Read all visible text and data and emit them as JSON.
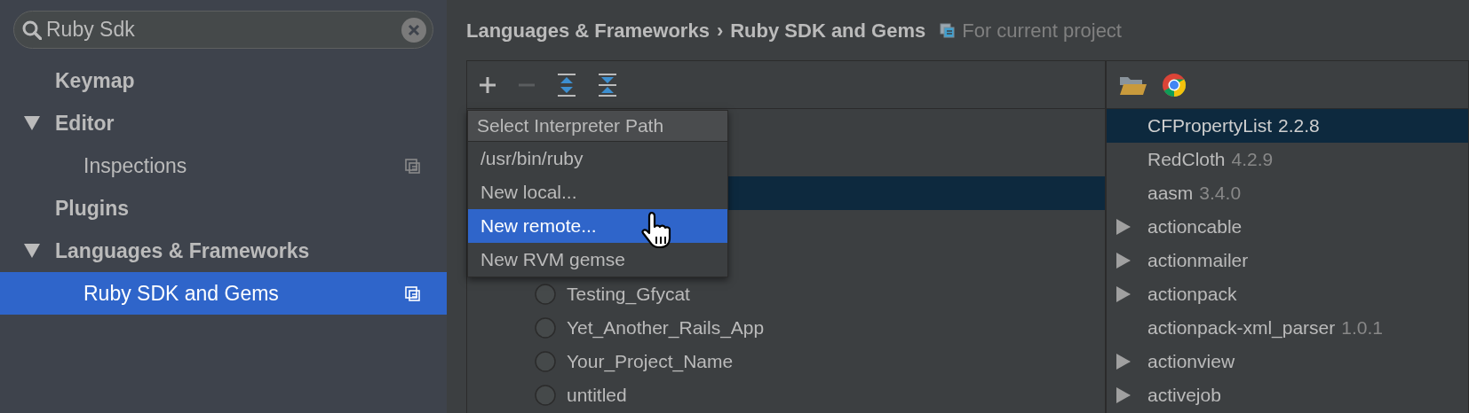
{
  "search": {
    "value": "Ruby Sdk"
  },
  "sidebar": {
    "items": [
      {
        "label": "Keymap",
        "selected": false,
        "project_level": false
      },
      {
        "label": "Editor",
        "selected": false,
        "project_level": false,
        "expanded": true,
        "children": [
          {
            "label": "Inspections",
            "selected": false,
            "project_level": true
          }
        ]
      },
      {
        "label": "Plugins",
        "selected": false,
        "project_level": false
      },
      {
        "label": "Languages & Frameworks",
        "selected": false,
        "project_level": false,
        "expanded": true,
        "children": [
          {
            "label": "Ruby SDK and Gems",
            "selected": true,
            "project_level": true
          }
        ]
      }
    ]
  },
  "breadcrumb": {
    "items": [
      "Languages & Frameworks",
      "Ruby SDK and Gems"
    ],
    "separator": "›",
    "scope": "For current project"
  },
  "toolbar": [
    {
      "kind": "add",
      "disabled": false
    },
    {
      "kind": "remove",
      "disabled": true
    },
    {
      "kind": "expand_all",
      "disabled": false
    },
    {
      "kind": "collapse_all",
      "disabled": false
    }
  ],
  "popup": {
    "title": "Select Interpreter Path",
    "items": [
      {
        "label": "/usr/bin/ruby",
        "selected": false
      },
      {
        "label": "New local...",
        "selected": false
      },
      {
        "label": "New remote...",
        "selected": true
      },
      {
        "label": "New RVM gemse",
        "selected": false
      }
    ]
  },
  "projects": [
    {
      "label": "Testing_Gfycat",
      "selected": false
    },
    {
      "label": "Yet_Another_Rails_App",
      "selected": false
    },
    {
      "label": "Your_Project_Name",
      "selected": false
    },
    {
      "label": "untitled",
      "selected": false
    }
  ],
  "gem_toolbar": [
    {
      "kind": "folder"
    },
    {
      "kind": "browser"
    }
  ],
  "gems": [
    {
      "name": "CFPropertyList",
      "version": "2.2.8",
      "expandable": false,
      "selected": true
    },
    {
      "name": "RedCloth",
      "version": "4.2.9",
      "expandable": false,
      "selected": false
    },
    {
      "name": "aasm",
      "version": "3.4.0",
      "expandable": false,
      "selected": false
    },
    {
      "name": "actioncable",
      "expandable": true,
      "selected": false
    },
    {
      "name": "actionmailer",
      "expandable": true,
      "selected": false
    },
    {
      "name": "actionpack",
      "expandable": true,
      "selected": false
    },
    {
      "name": "actionpack-xml_parser",
      "version": "1.0.1",
      "expandable": false,
      "selected": false
    },
    {
      "name": "actionview",
      "expandable": true,
      "selected": false
    },
    {
      "name": "activejob",
      "expandable": true,
      "selected": false
    }
  ]
}
